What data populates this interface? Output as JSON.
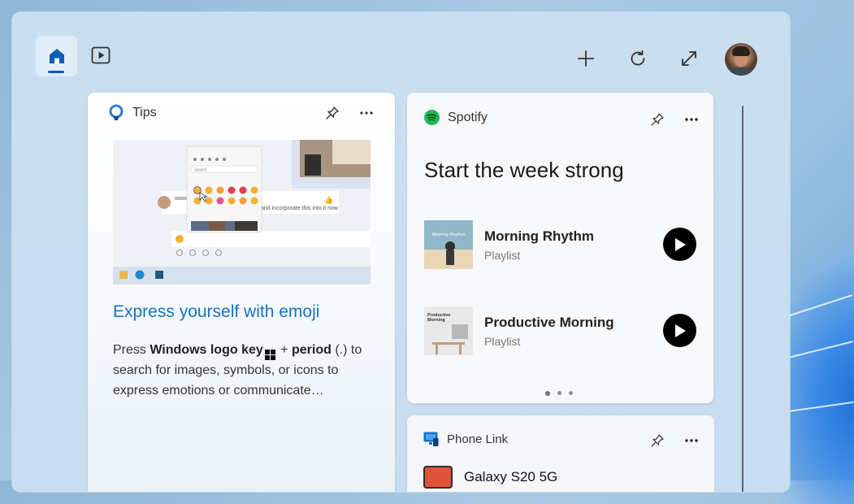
{
  "header": {
    "home_icon": "home-icon",
    "video_icon": "video-icon",
    "add_icon": "add-icon",
    "refresh_icon": "refresh-icon",
    "expand_icon": "expand-icon"
  },
  "tips": {
    "app_name": "Tips",
    "title": "Express yourself with emoji",
    "body_prefix": "Press ",
    "body_key1": "Windows logo key",
    "body_mid": " + ",
    "body_key2": "period",
    "body_suffix": " (.) to search for images, symbols, or icons to express emotions or communicate…",
    "image_chat_text": "and incorporate this into it now",
    "image_search_placeholder": "Search"
  },
  "spotify": {
    "app_name": "Spotify",
    "heading": "Start the week strong",
    "playlists": [
      {
        "title": "Morning Rhythm",
        "subtitle": "Playlist",
        "art_text": "Morning Rhythm"
      },
      {
        "title": "Productive Morning",
        "subtitle": "Playlist",
        "art_text": "Productive Morning"
      }
    ],
    "page_count": 3,
    "active_page": 1
  },
  "phone_link": {
    "app_name": "Phone Link",
    "device_name": "Galaxy S20 5G"
  },
  "colors": {
    "accent": "#1673c4",
    "spotify_green": "#1db954",
    "home_indicator": "#0f5bb5"
  }
}
